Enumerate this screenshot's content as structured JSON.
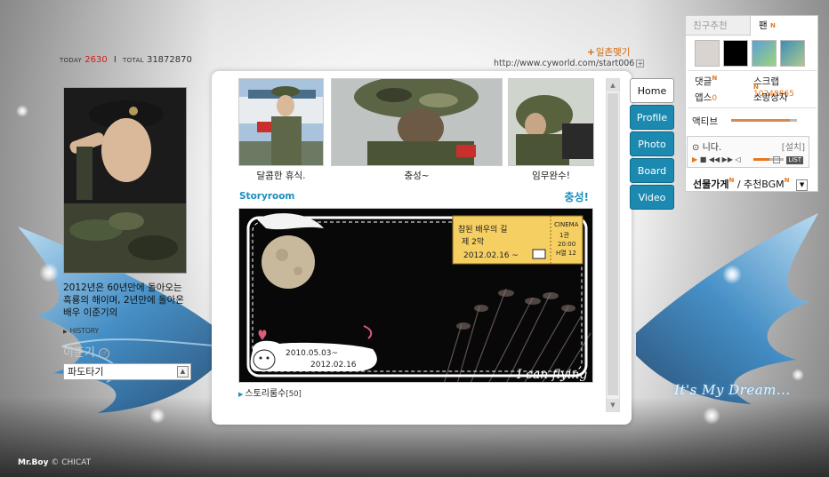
{
  "stats": {
    "today_label": "TODAY",
    "today_value": "2630",
    "sep": "I",
    "total_label": "TOTAL",
    "total_value": "31872870"
  },
  "profile": {
    "bio": "2012년은 60년만에 돌아오는 흑룡의 해이며, 2년만에 돌아온 배우 이준기의",
    "history_label": "HISTORY",
    "name": "이준기",
    "gender_symbol": "♂",
    "select_value": "파도타기"
  },
  "header": {
    "add_link": "일촌맺기",
    "add_plus": "+",
    "url": "http://www.cyworld.com/start006",
    "url_box": "+"
  },
  "gallery": [
    {
      "caption": "달콤한 휴식."
    },
    {
      "caption": "충성~"
    },
    {
      "caption": "임무완수!"
    }
  ],
  "storyroom": {
    "title": "Storyroom",
    "tag": "충성!",
    "ticket_line1": "참된 배우의 길",
    "ticket_line2": "제 2막",
    "ticket_line3": "2012.02.16 ~",
    "ticket_right1": "CINEMA",
    "ticket_right2": "1관",
    "ticket_right3": "20:00",
    "ticket_right4": "H열 12",
    "date_start": "2010.05.03~",
    "date_end": "2012.02.16",
    "signature": "I can flying",
    "footer_label": "스토리룸수",
    "footer_count": "[50]"
  },
  "tabs": [
    "Home",
    "Profile",
    "Photo",
    "Board",
    "Video"
  ],
  "widget": {
    "tab_recommend": "친구추천",
    "tab_fan": "팬",
    "badge": "N",
    "comments_label": "댓글",
    "scrap_label": "스크랩",
    "scrap_count": "10248865",
    "apps_label": "앱스",
    "apps_count": "0",
    "wish_label": "소망상자",
    "active_label": "액티브"
  },
  "player": {
    "track": "니다.",
    "install": "[설치]",
    "list": "LIST"
  },
  "gift": {
    "shop": "선물가게",
    "bgm": "/ 추천BGM"
  },
  "decor": {
    "dream_text": "It's My Dream...",
    "credit_brand": "Mr.Boy",
    "credit_rest": "© CHICAT"
  }
}
